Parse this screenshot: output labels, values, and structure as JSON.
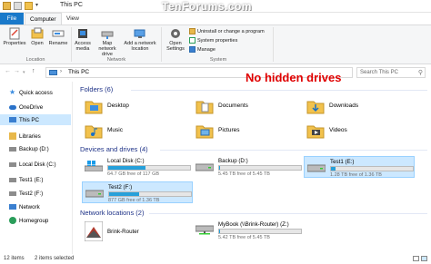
{
  "window": {
    "title": "This PC",
    "watermark": "TenForums.com"
  },
  "tabs": {
    "file": "File",
    "computer": "Computer",
    "view": "View"
  },
  "ribbon": {
    "location": {
      "label": "Location",
      "properties": "Properties",
      "open": "Open",
      "rename": "Rename"
    },
    "network": {
      "label": "Network",
      "access_media": "Access media",
      "map_drive": "Map network drive",
      "add_location": "Add a network location"
    },
    "system": {
      "label": "System",
      "open_settings": "Open Settings",
      "uninstall": "Uninstall or change a program",
      "system_properties": "System properties",
      "manage": "Manage"
    }
  },
  "address": {
    "path": "This PC",
    "search_placeholder": "Search This PC"
  },
  "nav": [
    {
      "label": "Quick access",
      "icon": "star-icon",
      "color": "#3b8de0"
    },
    {
      "label": "OneDrive",
      "icon": "cloud-icon",
      "color": "#2a72c9"
    },
    {
      "label": "This PC",
      "icon": "computer-icon",
      "color": "#3a7fd0",
      "selected": true
    },
    {
      "label": "Libraries",
      "icon": "library-icon",
      "color": "#e8b84a"
    },
    {
      "label": "Backup (D:)",
      "icon": "drive-icon",
      "color": "#8c8c8c"
    },
    {
      "label": "Local Disk (C:)",
      "icon": "drive-icon",
      "color": "#8c8c8c"
    },
    {
      "label": "Test1 (E:)",
      "icon": "drive-icon",
      "color": "#8c8c8c"
    },
    {
      "label": "Test2 (F:)",
      "icon": "drive-icon",
      "color": "#8c8c8c"
    },
    {
      "label": "Network",
      "icon": "network-icon",
      "color": "#3a7fd0"
    },
    {
      "label": "Homegroup",
      "icon": "homegroup-icon",
      "color": "#2a9d5a"
    }
  ],
  "annotation": "No hidden drives",
  "folders": {
    "header": "Folders (6)",
    "items": [
      {
        "label": "Desktop",
        "icon": "desktop-folder-icon"
      },
      {
        "label": "Documents",
        "icon": "documents-folder-icon"
      },
      {
        "label": "Downloads",
        "icon": "downloads-folder-icon"
      },
      {
        "label": "Music",
        "icon": "music-folder-icon"
      },
      {
        "label": "Pictures",
        "icon": "pictures-folder-icon"
      },
      {
        "label": "Videos",
        "icon": "videos-folder-icon"
      }
    ]
  },
  "drives": {
    "header": "Devices and drives (4)",
    "items": [
      {
        "name": "Local Disk (C:)",
        "space": "64.7 GB free of 117 GB",
        "used_fraction": 0.45,
        "icon": "windows-drive-icon"
      },
      {
        "name": "Backup (D:)",
        "space": "5.45 TB free of 5.45 TB",
        "used_fraction": 0.01,
        "icon": "drive-icon"
      },
      {
        "name": "Test1 (E:)",
        "space": "1.28 TB free of 1.36 TB",
        "used_fraction": 0.06,
        "icon": "drive-icon",
        "selected": true
      },
      {
        "name": "Test2 (F:)",
        "space": "877 GB free of 1.36 TB",
        "used_fraction": 0.37,
        "icon": "drive-icon",
        "selected": true
      }
    ]
  },
  "network_locations": {
    "header": "Network locations (2)",
    "items": [
      {
        "name": "Brink-Router",
        "icon": "router-icon"
      },
      {
        "name": "MyBook (\\\\Brink-Router) (Z:)",
        "space": "5.42 TB free of 5.45 TB",
        "used_fraction": 0.01,
        "icon": "network-drive-icon"
      }
    ]
  },
  "status": {
    "items": "12 items",
    "selected": "2 items selected"
  }
}
